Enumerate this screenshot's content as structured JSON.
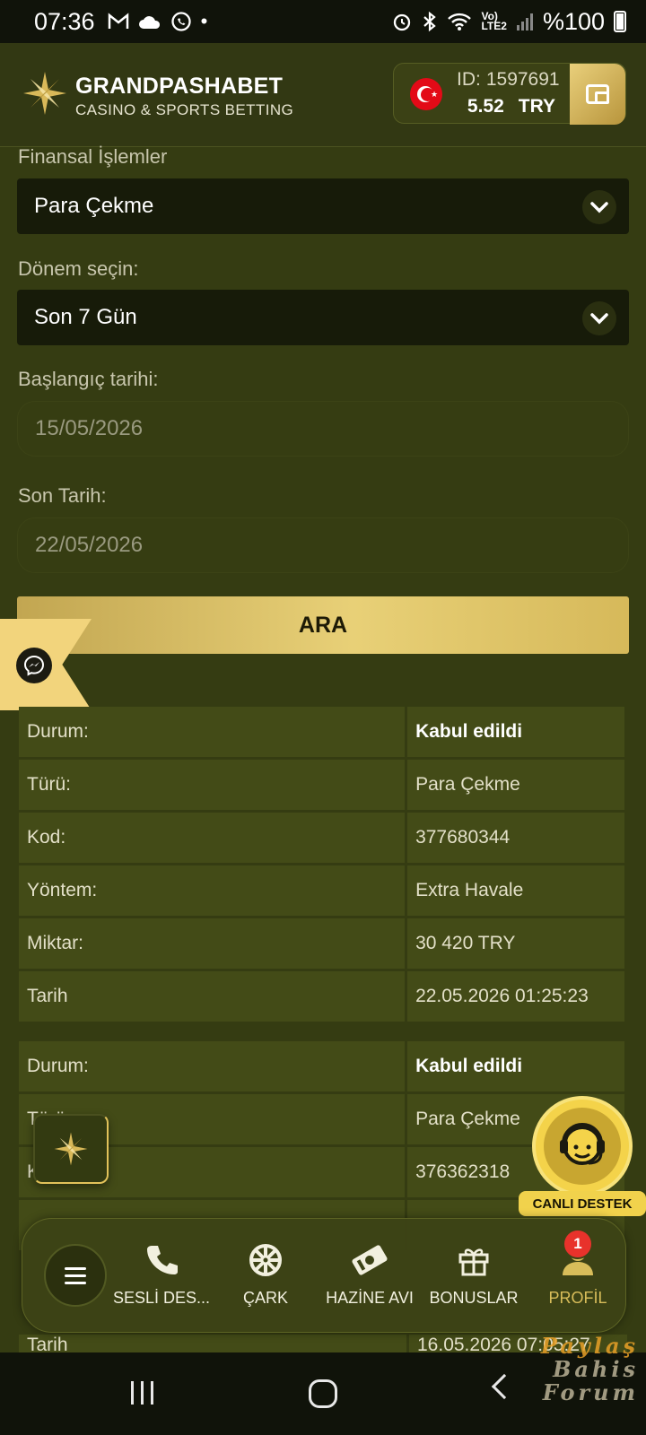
{
  "status_bar": {
    "time": "07:36",
    "battery": "%100",
    "network": "LTE2"
  },
  "header": {
    "brand_name": "GRANDPASHABET",
    "brand_tagline": "CASINO & SPORTS BETTING",
    "account_id_label": "ID:",
    "account_id": "1597691",
    "balance": "5.52",
    "currency": "TRY"
  },
  "form": {
    "financial_label": "Finansal İşlemler",
    "financial_value": "Para Çekme",
    "period_label": "Dönem seçin:",
    "period_value": "Son 7 Gün",
    "start_label": "Başlangıç tarihi:",
    "start_value": "15/05/2026",
    "end_label": "Son Tarih:",
    "end_value": "22/05/2026",
    "search_button": "ARA"
  },
  "transactions": [
    {
      "rows": [
        {
          "key": "Durum:",
          "value": "Kabul edildi"
        },
        {
          "key": "Türü:",
          "value": "Para Çekme"
        },
        {
          "key": "Kod:",
          "value": "377680344"
        },
        {
          "key": "Yöntem:",
          "value": "Extra Havale"
        },
        {
          "key": "Miktar:",
          "value": "30 420 TRY"
        },
        {
          "key": "Tarih",
          "value": "22.05.2026 01:25:23"
        }
      ]
    },
    {
      "rows": [
        {
          "key": "Durum:",
          "value": "Kabul edildi"
        },
        {
          "key": "Türü:",
          "value": "Para Çekme"
        },
        {
          "key": "Kod:",
          "value": "376362318"
        },
        {
          "key": "Tarih",
          "value": "16.05.2026 07:05:27"
        }
      ]
    }
  ],
  "support": {
    "label": "CANLI DESTEK"
  },
  "bottom_nav": {
    "items": [
      {
        "label": "SESLİ DES...",
        "icon": "phone-icon"
      },
      {
        "label": "ÇARK",
        "icon": "wheel-icon"
      },
      {
        "label": "HAZİNE AVI",
        "icon": "ticket-icon"
      },
      {
        "label": "BONUSLAR",
        "icon": "gift-icon"
      },
      {
        "label": "PROFİL",
        "icon": "user-icon"
      }
    ],
    "profile_badge": "1"
  },
  "watermark": {
    "line1": "Paylaş",
    "line2": "Bahis Forum"
  },
  "colors": {
    "background": "#353c12",
    "gold_accent": "#e2c25a",
    "badge_red": "#e8322b"
  }
}
